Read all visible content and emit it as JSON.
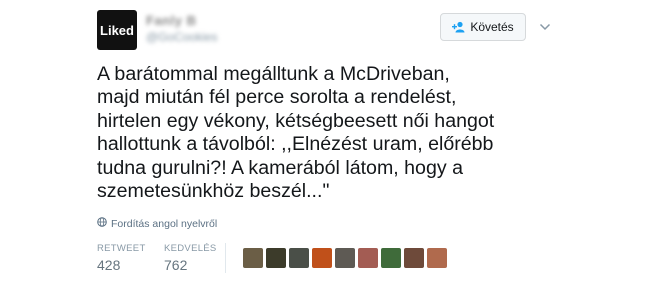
{
  "header": {
    "avatar_text": "Liked",
    "display_name": "Fanly B",
    "handle": "@GoCookies",
    "follow_label": "Követés"
  },
  "tweet": {
    "lines": [
      "A barátommal megálltunk a McDriveban,",
      "majd miután fél perce sorolta a rendelést,",
      "hirtelen egy vékony, kétségbeesett női hangot",
      "hallottunk a távolból: ,,Elnézést uram, előrébb",
      "tudna gurulni?! A kamerából látom, hogy a",
      "szemetesünkhöz beszél...\""
    ]
  },
  "translate": {
    "label": "Fordítás angol nyelvről",
    "icon": "globe-icon"
  },
  "stats": {
    "retweet_label": "RETWEET",
    "retweet_count": "428",
    "like_label": "KEDVELÉS",
    "like_count": "762"
  },
  "likers": [
    {
      "name": "liker-avatar-1",
      "color": "#6b5e46"
    },
    {
      "name": "liker-avatar-2",
      "color": "#3c3b2a"
    },
    {
      "name": "liker-avatar-3",
      "color": "#4a4f48"
    },
    {
      "name": "liker-avatar-4",
      "color": "#c0501a"
    },
    {
      "name": "liker-avatar-5",
      "color": "#5e5a54"
    },
    {
      "name": "liker-avatar-6",
      "color": "#a35c53"
    },
    {
      "name": "liker-avatar-7",
      "color": "#3f6b3a"
    },
    {
      "name": "liker-avatar-8",
      "color": "#6e4a3a"
    },
    {
      "name": "liker-avatar-9",
      "color": "#b06a4d"
    }
  ]
}
